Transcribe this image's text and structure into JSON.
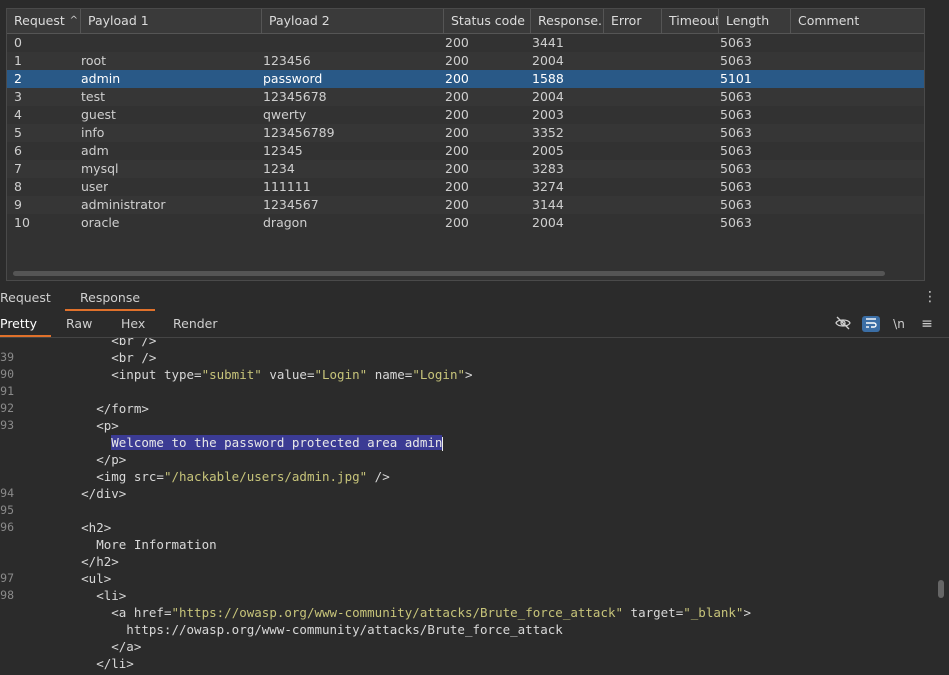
{
  "table": {
    "columns": [
      "Request",
      "Payload 1",
      "Payload 2",
      "Status code",
      "Response...",
      "Error",
      "Timeout",
      "Length",
      "Comment"
    ],
    "sort_indicator": "^",
    "rows": [
      {
        "request": "0",
        "payload1": "",
        "payload2": "",
        "status": "200",
        "response": "3441",
        "error": "",
        "timeout": "",
        "length": "5063",
        "comment": ""
      },
      {
        "request": "1",
        "payload1": "root",
        "payload2": "123456",
        "status": "200",
        "response": "2004",
        "error": "",
        "timeout": "",
        "length": "5063",
        "comment": ""
      },
      {
        "request": "2",
        "payload1": "admin",
        "payload2": "password",
        "status": "200",
        "response": "1588",
        "error": "",
        "timeout": "",
        "length": "5101",
        "comment": ""
      },
      {
        "request": "3",
        "payload1": "test",
        "payload2": "12345678",
        "status": "200",
        "response": "2004",
        "error": "",
        "timeout": "",
        "length": "5063",
        "comment": ""
      },
      {
        "request": "4",
        "payload1": "guest",
        "payload2": "qwerty",
        "status": "200",
        "response": "2003",
        "error": "",
        "timeout": "",
        "length": "5063",
        "comment": ""
      },
      {
        "request": "5",
        "payload1": "info",
        "payload2": "123456789",
        "status": "200",
        "response": "3352",
        "error": "",
        "timeout": "",
        "length": "5063",
        "comment": ""
      },
      {
        "request": "6",
        "payload1": "adm",
        "payload2": "12345",
        "status": "200",
        "response": "2005",
        "error": "",
        "timeout": "",
        "length": "5063",
        "comment": ""
      },
      {
        "request": "7",
        "payload1": "mysql",
        "payload2": "1234",
        "status": "200",
        "response": "3283",
        "error": "",
        "timeout": "",
        "length": "5063",
        "comment": ""
      },
      {
        "request": "8",
        "payload1": "user",
        "payload2": "111111",
        "status": "200",
        "response": "3274",
        "error": "",
        "timeout": "",
        "length": "5063",
        "comment": ""
      },
      {
        "request": "9",
        "payload1": "administrator",
        "payload2": "1234567",
        "status": "200",
        "response": "3144",
        "error": "",
        "timeout": "",
        "length": "5063",
        "comment": ""
      },
      {
        "request": "10",
        "payload1": "oracle",
        "payload2": "dragon",
        "status": "200",
        "response": "2004",
        "error": "",
        "timeout": "",
        "length": "5063",
        "comment": ""
      }
    ]
  },
  "panel_tabs": [
    "Request",
    "Response"
  ],
  "view_tabs": [
    "Pretty",
    "Raw",
    "Hex",
    "Render"
  ],
  "toolbar": {
    "newline_label": "\\n",
    "menu_label": "≡",
    "kebab_label": "⋮",
    "hide_icon": "eye-off-icon",
    "wrap_icon": "wrap-icon"
  },
  "editor": {
    "line_numbers": [
      "39",
      "90",
      "91",
      "92",
      "93",
      "94",
      "95",
      "96",
      "97",
      "98"
    ],
    "lines": [
      {
        "num": "",
        "parts": [
          {
            "t": "tag",
            "v": "          <br />"
          }
        ]
      },
      {
        "num": "39",
        "parts": [
          {
            "t": "tag",
            "v": "          <br />"
          }
        ]
      },
      {
        "num": "90",
        "parts": [
          {
            "t": "tag",
            "v": "          <input "
          },
          {
            "t": "attr",
            "v": "type="
          },
          {
            "t": "val",
            "v": "\"submit\""
          },
          {
            "t": "attr",
            "v": " value="
          },
          {
            "t": "val",
            "v": "\"Login\""
          },
          {
            "t": "attr",
            "v": " name="
          },
          {
            "t": "val",
            "v": "\"Login\""
          },
          {
            "t": "tag",
            "v": ">"
          }
        ]
      },
      {
        "num": "91",
        "parts": []
      },
      {
        "num": "92",
        "parts": [
          {
            "t": "tag",
            "v": "        </form>"
          }
        ]
      },
      {
        "num": "93",
        "parts": [
          {
            "t": "tag",
            "v": "        <p>"
          }
        ]
      },
      {
        "num": "",
        "parts": [
          {
            "t": "txt",
            "v": "          "
          },
          {
            "t": "hl",
            "v": "Welcome to the password protected area admin"
          }
        ]
      },
      {
        "num": "",
        "parts": [
          {
            "t": "tag",
            "v": "        </p>"
          }
        ]
      },
      {
        "num": "",
        "parts": [
          {
            "t": "tag",
            "v": "        <img "
          },
          {
            "t": "attr",
            "v": "src="
          },
          {
            "t": "val",
            "v": "\"/hackable/users/admin.jpg\""
          },
          {
            "t": "tag",
            "v": " />"
          }
        ]
      },
      {
        "num": "94",
        "parts": [
          {
            "t": "tag",
            "v": "      </div>"
          }
        ]
      },
      {
        "num": "95",
        "parts": []
      },
      {
        "num": "96",
        "parts": [
          {
            "t": "tag",
            "v": "      <h2>"
          }
        ]
      },
      {
        "num": "",
        "parts": [
          {
            "t": "txt",
            "v": "        More Information"
          }
        ]
      },
      {
        "num": "",
        "parts": [
          {
            "t": "tag",
            "v": "      </h2>"
          }
        ]
      },
      {
        "num": "97",
        "parts": [
          {
            "t": "tag",
            "v": "      <ul>"
          }
        ]
      },
      {
        "num": "98",
        "parts": [
          {
            "t": "tag",
            "v": "        <li>"
          }
        ]
      },
      {
        "num": "",
        "parts": [
          {
            "t": "tag",
            "v": "          <a "
          },
          {
            "t": "attr",
            "v": "href="
          },
          {
            "t": "val",
            "v": "\"https://owasp.org/www-community/attacks/Brute_force_attack\""
          },
          {
            "t": "attr",
            "v": " target="
          },
          {
            "t": "val",
            "v": "\"_blank\""
          },
          {
            "t": "tag",
            "v": ">"
          }
        ]
      },
      {
        "num": "",
        "parts": [
          {
            "t": "txt",
            "v": "            https://owasp.org/www-community/attacks/Brute_force_attack"
          }
        ]
      },
      {
        "num": "",
        "parts": [
          {
            "t": "tag",
            "v": "          </a>"
          }
        ]
      },
      {
        "num": "",
        "parts": [
          {
            "t": "tag",
            "v": "        </li>"
          }
        ]
      }
    ]
  }
}
